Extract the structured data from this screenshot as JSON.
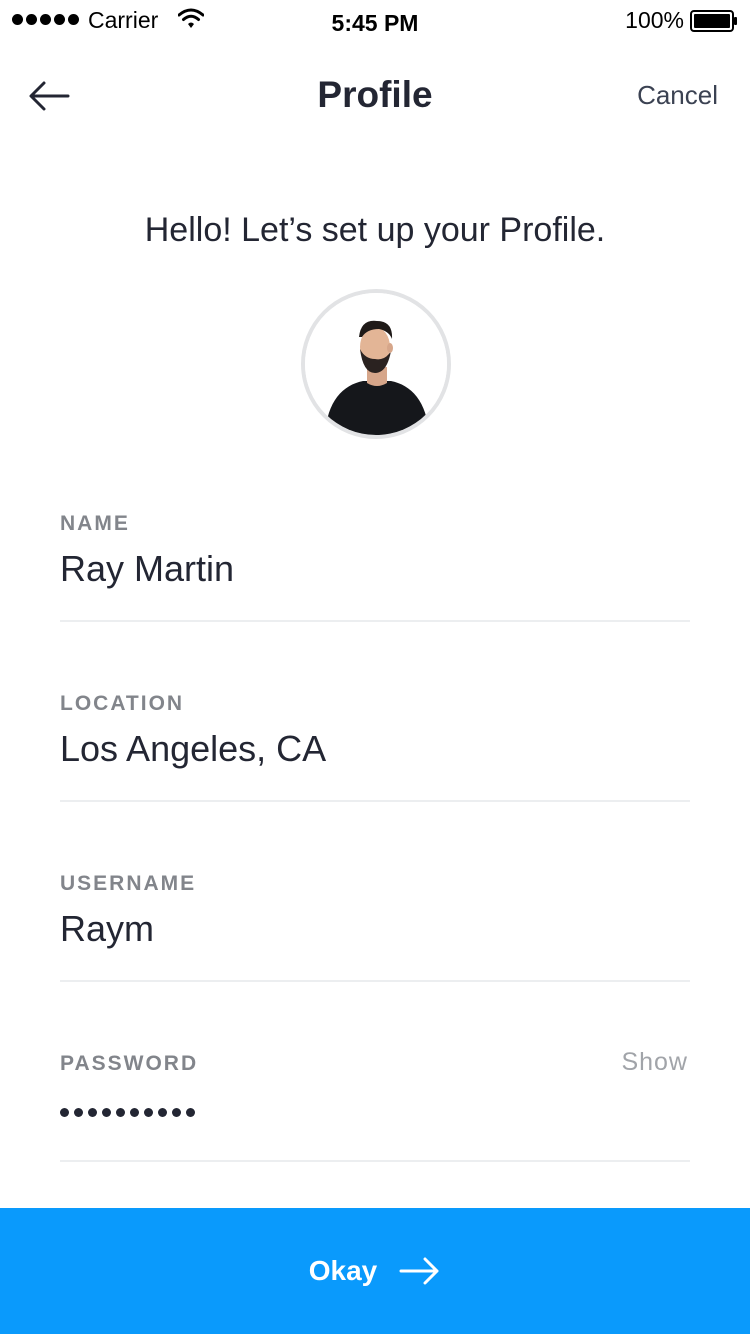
{
  "status_bar": {
    "carrier": "Carrier",
    "time": "5:45 PM",
    "battery": "100%",
    "signal_icon": "signal-dots-icon",
    "wifi_icon": "wifi-icon",
    "battery_icon": "battery-icon"
  },
  "nav": {
    "title": "Profile",
    "back_icon": "arrow-left-icon",
    "cancel_label": "Cancel"
  },
  "greeting": "Hello! Let’s set up your Profile.",
  "fields": {
    "name": {
      "label": "NAME",
      "value": "Ray Martin"
    },
    "location": {
      "label": "LOCATION",
      "value": "Los Angeles, CA"
    },
    "username": {
      "label": "USERNAME",
      "value": "Raym"
    },
    "password": {
      "label": "PASSWORD",
      "masked_length": 10,
      "show_label": "Show"
    }
  },
  "actions": {
    "okay_label": "Okay",
    "okay_icon": "arrow-right-icon"
  },
  "colors": {
    "primary": "#0a9afc",
    "text": "#232633",
    "label": "#82858b",
    "muted": "#a1a4a9",
    "divider": "#eceef0"
  }
}
